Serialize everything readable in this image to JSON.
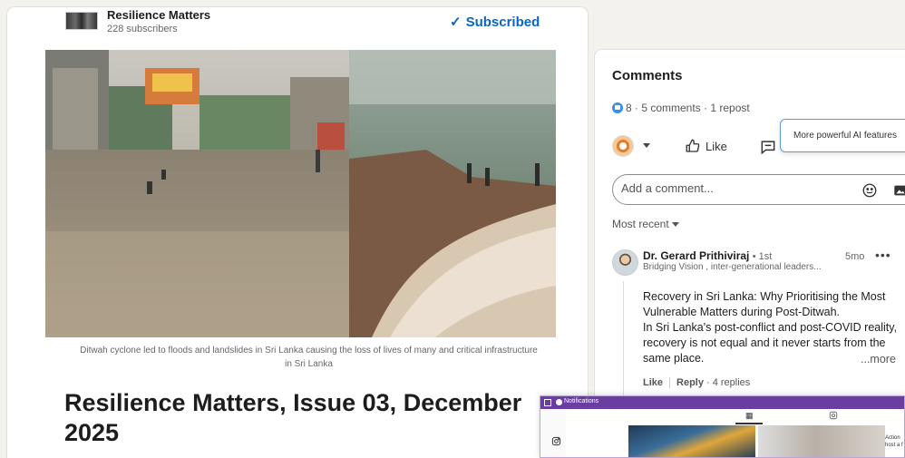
{
  "publication": {
    "name": "Resilience Matters",
    "subscribers": "228 subscribers",
    "subscribed_label": "Subscribed"
  },
  "article": {
    "caption": "Ditwah cyclone led to floods and landslides in Sri Lanka causing the loss of lives of many and critical infrastructure in Sri Lanka",
    "headline": "Resilience Matters, Issue 03, December 2025"
  },
  "comments_panel": {
    "title": "Comments",
    "stats": "8 · 5 comments · 1 repost",
    "like_label": "Like",
    "tooltip": "More powerful AI features",
    "add_comment_placeholder": "Add a comment...",
    "sort_label": "Most recent",
    "comment": {
      "author": "Dr. Gerard Prithiviraj",
      "degree": "• 1st",
      "tagline": "Bridging Vision , inter-generational leaders...",
      "time": "5mo",
      "more_dots": "•••",
      "body": "Recovery in Sri Lanka: Why Prioritising the Most Vulnerable Matters during Post-Ditwah.\nIn Sri Lanka's post-conflict and post-COVID reality, recovery is not equal and it never starts from the same place.",
      "more": "...more",
      "like_link": "Like",
      "reply_link": "Reply",
      "replies": "· 4 replies"
    }
  },
  "overlay": {
    "title": "Notifications",
    "side_text": "Action host a f"
  },
  "colors": {
    "accent": "#0a66c2",
    "overlay_bar": "#6a3ea1"
  }
}
